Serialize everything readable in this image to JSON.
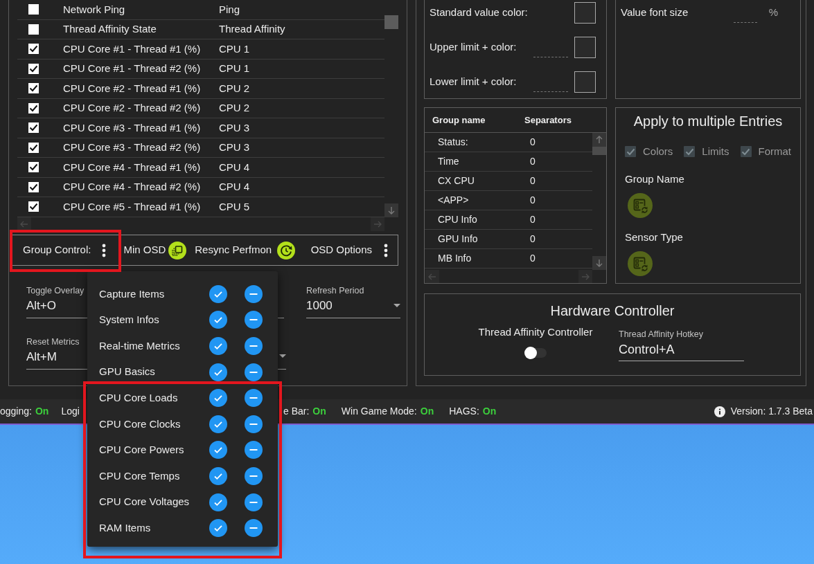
{
  "sensor_table": {
    "rows": [
      {
        "checked": false,
        "column_2": "Network Ping",
        "column_3": "Ping"
      },
      {
        "checked": false,
        "column_2": "Thread Affinity State",
        "column_3": "Thread Affinity"
      },
      {
        "checked": true,
        "column_2": "CPU Core #1 - Thread #1 (%)",
        "column_3": "CPU 1"
      },
      {
        "checked": true,
        "column_2": "CPU Core #1 - Thread #2 (%)",
        "column_3": "CPU 1"
      },
      {
        "checked": true,
        "column_2": "CPU Core #2 - Thread #1 (%)",
        "column_3": "CPU 2"
      },
      {
        "checked": true,
        "column_2": "CPU Core #2 - Thread #2 (%)",
        "column_3": "CPU 2"
      },
      {
        "checked": true,
        "column_2": "CPU Core #3 - Thread #1 (%)",
        "column_3": "CPU 3"
      },
      {
        "checked": true,
        "column_2": "CPU Core #3 - Thread #2 (%)",
        "column_3": "CPU 3"
      },
      {
        "checked": true,
        "column_2": "CPU Core #4 - Thread #1 (%)",
        "column_3": "CPU 4"
      },
      {
        "checked": true,
        "column_2": "CPU Core #4 - Thread #2 (%)",
        "column_3": "CPU 4"
      },
      {
        "checked": true,
        "column_2": "CPU Core #5 - Thread #1 (%)",
        "column_3": "CPU 5"
      }
    ]
  },
  "group_control": {
    "label": "Group Control:",
    "actions": [
      {
        "label": "Min OSD",
        "kind": "stack"
      },
      {
        "label": "Resync Perfmon",
        "kind": "resync"
      }
    ],
    "options_label": "OSD Options"
  },
  "hotkeys": [
    {
      "label": "Toggle Overlay",
      "value": "Alt+O"
    },
    {
      "label": "Reset Metrics",
      "value": "Alt+M"
    }
  ],
  "refresh_period": {
    "label": "Refresh Period",
    "value": "1000"
  },
  "color_settings": [
    {
      "label": "Standard value color:",
      "kind": "swatch"
    },
    {
      "label": "Upper limit + color:",
      "kind": "limit"
    },
    {
      "label": "Lower limit + color:",
      "kind": "limit"
    }
  ],
  "font_size": {
    "label": "Value font size",
    "unit": "%"
  },
  "group_table": {
    "columns": [
      "Group name",
      "Separators"
    ],
    "rows": [
      [
        "Status:",
        "0"
      ],
      [
        "Time",
        "0"
      ],
      [
        "CX CPU",
        "0"
      ],
      [
        "<APP>",
        "0"
      ],
      [
        "CPU Info",
        "0"
      ],
      [
        "GPU Info",
        "0"
      ],
      [
        "MB Info",
        "0"
      ]
    ]
  },
  "apply_panel": {
    "title": "Apply to multiple Entries",
    "options": [
      {
        "label": "Colors",
        "checked": true,
        "disabled": true
      },
      {
        "label": "Limits",
        "checked": true,
        "disabled": true
      },
      {
        "label": "Format",
        "checked": true,
        "disabled": true
      }
    ],
    "actions": [
      {
        "label": "Group Name"
      },
      {
        "label": "Sensor Type"
      }
    ]
  },
  "hardware": {
    "title": "Hardware Controller",
    "toggle": {
      "label": "Thread Affinity Controller",
      "on": false
    },
    "hotkey": {
      "label": "Thread Affinity Hotkey",
      "value": "Control+A"
    }
  },
  "status_bar": {
    "items": [
      {
        "label": "ogging:",
        "value": "On"
      },
      {
        "label": "Logi"
      },
      {
        "label": "e Bar:",
        "value": "On"
      },
      {
        "label": "Win Game Mode:",
        "value": "On"
      },
      {
        "label": "HAGS:",
        "value": "On"
      }
    ],
    "version": "Version: 1.7.3 Beta"
  },
  "group_menu": {
    "items": [
      {
        "label": "Capture Items"
      },
      {
        "label": "System Infos"
      },
      {
        "label": "Real-time Metrics"
      },
      {
        "label": "GPU Basics"
      },
      {
        "label": "CPU Core Loads"
      },
      {
        "label": "CPU Core Clocks"
      },
      {
        "label": "CPU Core Powers"
      },
      {
        "label": "CPU Core Temps"
      },
      {
        "label": "CPU Core Voltages"
      },
      {
        "label": "RAM Items"
      }
    ]
  }
}
